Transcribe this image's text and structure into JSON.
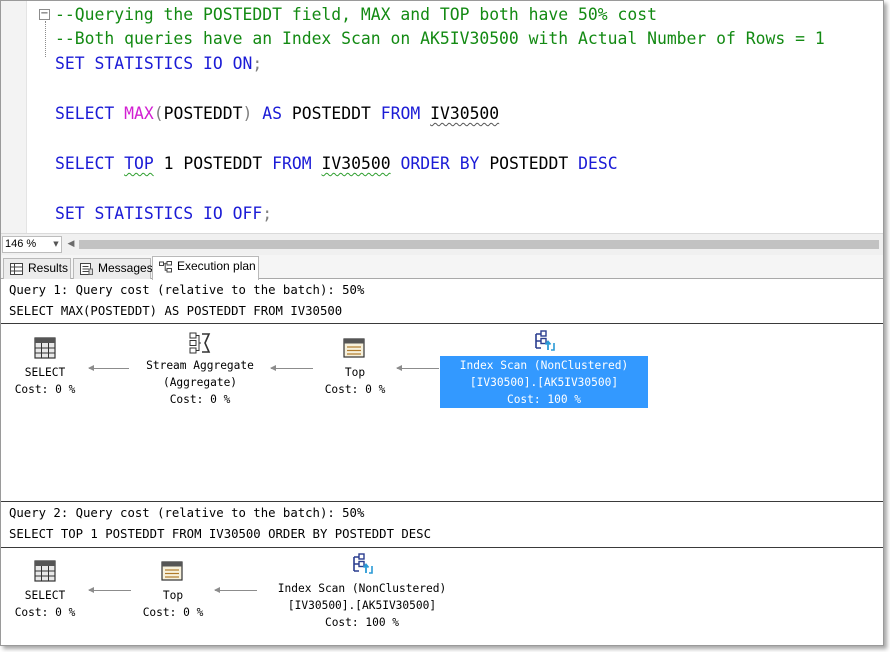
{
  "editor": {
    "line1": "--Querying the POSTEDDT field, MAX and TOP both have 50% cost",
    "line2": "--Both queries have an Index Scan on AK5IV30500 with Actual Number of Rows = 1",
    "line3": {
      "kw_set": "SET",
      "kw_stats": "STATISTICS",
      "kw_io": "IO",
      "kw_on": "ON",
      "punct": ";"
    },
    "line4": {
      "kw_select": "SELECT",
      "fn_max": "MAX",
      "paren_open": "(",
      "col": "POSTEDDT",
      "paren_close": ")",
      "kw_as": "AS",
      "alias": "POSTEDDT",
      "kw_from": "FROM",
      "table": "IV30500"
    },
    "line5": {
      "kw_select": "SELECT",
      "kw_top": "TOP",
      "num": "1",
      "col": "POSTEDDT",
      "kw_from": "FROM",
      "table": "IV30500",
      "kw_order": "ORDER",
      "kw_by": "BY",
      "col2": "POSTEDDT",
      "kw_desc": "DESC"
    },
    "line6": {
      "kw_set": "SET",
      "kw_stats": "STATISTICS",
      "kw_io": "IO",
      "kw_off": "OFF",
      "punct": ";"
    },
    "fold_symbol": "−"
  },
  "zoom": {
    "value": "146 %",
    "arrow": "▼",
    "scroll_left": "◀"
  },
  "tabs": [
    {
      "label": "Results"
    },
    {
      "label": "Messages"
    },
    {
      "label": "Execution plan"
    }
  ],
  "plan": {
    "query1": {
      "header": "Query 1: Query cost (relative to the batch): 50%",
      "statement": "SELECT MAX(POSTEDDT) AS POSTEDDT FROM IV30500",
      "ops": {
        "select": {
          "name": "SELECT",
          "cost": "Cost: 0 %"
        },
        "stream_aggregate": {
          "name": "Stream Aggregate",
          "sub": "(Aggregate)",
          "cost": "Cost: 0 %"
        },
        "top": {
          "name": "Top",
          "cost": "Cost: 0 %"
        },
        "index_scan": {
          "name": "Index Scan (NonClustered)",
          "object": "[IV30500].[AK5IV30500]",
          "cost": "Cost: 100 %"
        }
      }
    },
    "query2": {
      "header": "Query 2: Query cost (relative to the batch): 50%",
      "statement": "SELECT TOP 1 POSTEDDT FROM IV30500 ORDER BY POSTEDDT DESC",
      "ops": {
        "select": {
          "name": "SELECT",
          "cost": "Cost: 0 %"
        },
        "top": {
          "name": "Top",
          "cost": "Cost: 0 %"
        },
        "index_scan": {
          "name": "Index Scan (NonClustered)",
          "object": "[IV30500].[AK5IV30500]",
          "cost": "Cost: 100 %"
        }
      }
    }
  },
  "colors": {
    "keyword": "#1b1bd6",
    "function": "#d21fd2",
    "comment": "#138a13",
    "selection": "#3399ff"
  }
}
